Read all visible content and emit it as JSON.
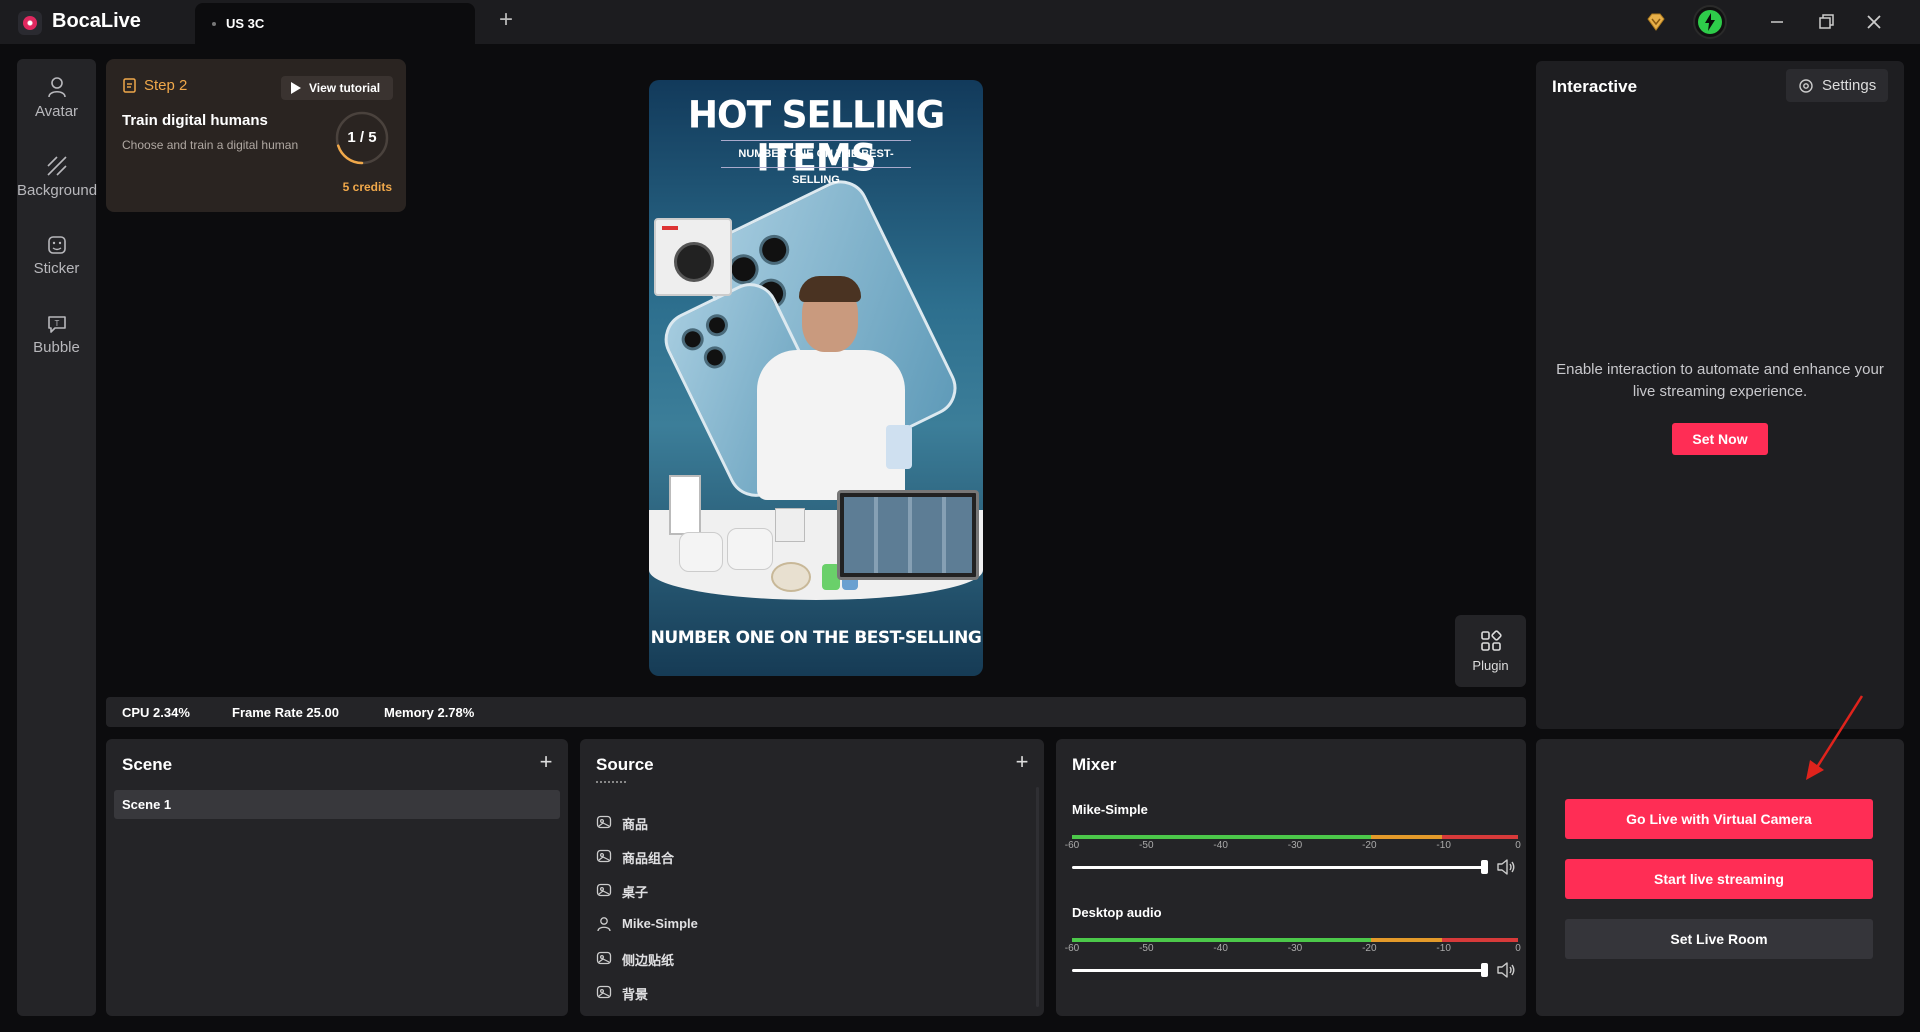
{
  "app": {
    "name": "BocaLive"
  },
  "tabs": [
    {
      "label": "US 3C"
    }
  ],
  "left_rail": [
    {
      "label": "Avatar",
      "icon": "avatar-icon"
    },
    {
      "label": "Background",
      "icon": "background-icon"
    },
    {
      "label": "Sticker",
      "icon": "sticker-icon"
    },
    {
      "label": "Bubble",
      "icon": "bubble-icon"
    }
  ],
  "step_card": {
    "step": "Step 2",
    "tutorial": "View tutorial",
    "title": "Train digital humans",
    "desc": "Choose and train a digital human",
    "progress": "1 / 5",
    "progress_value": 0.2,
    "credits": "5 credits"
  },
  "preview": {
    "title": "HOT SELLING ITEMS",
    "subtitle": "NUMBER ONE ON THE BEST-SELLING",
    "bottom": "NUMBER ONE ON THE BEST-SELLING"
  },
  "plugin": {
    "label": "Plugin"
  },
  "stats": {
    "cpu": "CPU 2.34%",
    "frame_rate": "Frame Rate 25.00",
    "memory": "Memory 2.78%"
  },
  "interactive": {
    "title": "Interactive",
    "settings": "Settings",
    "desc": "Enable interaction to automate and enhance your live streaming experience.",
    "set_now": "Set Now"
  },
  "scene": {
    "title": "Scene",
    "items": [
      "Scene 1"
    ]
  },
  "source": {
    "title": "Source",
    "items": [
      {
        "label": "商品",
        "icon": "image-icon"
      },
      {
        "label": "商品组合",
        "icon": "image-icon"
      },
      {
        "label": "桌子",
        "icon": "image-icon"
      },
      {
        "label": "Mike-Simple",
        "icon": "person-icon"
      },
      {
        "label": "侧边贴纸",
        "icon": "image-icon"
      },
      {
        "label": "背景",
        "icon": "image-icon"
      }
    ]
  },
  "mixer": {
    "title": "Mixer",
    "channels": [
      {
        "name": "Mike-Simple",
        "volume": 1.0
      },
      {
        "name": "Desktop audio",
        "volume": 1.0
      }
    ],
    "ticks": [
      "-60",
      "-50",
      "-40",
      "-30",
      "-20",
      "-10",
      "0"
    ]
  },
  "golive": {
    "virtual_camera": "Go Live with Virtual Camera",
    "start": "Start live streaming",
    "room": "Set Live Room"
  },
  "colors": {
    "accent": "#ff2d55",
    "step": "#f0a84a"
  }
}
